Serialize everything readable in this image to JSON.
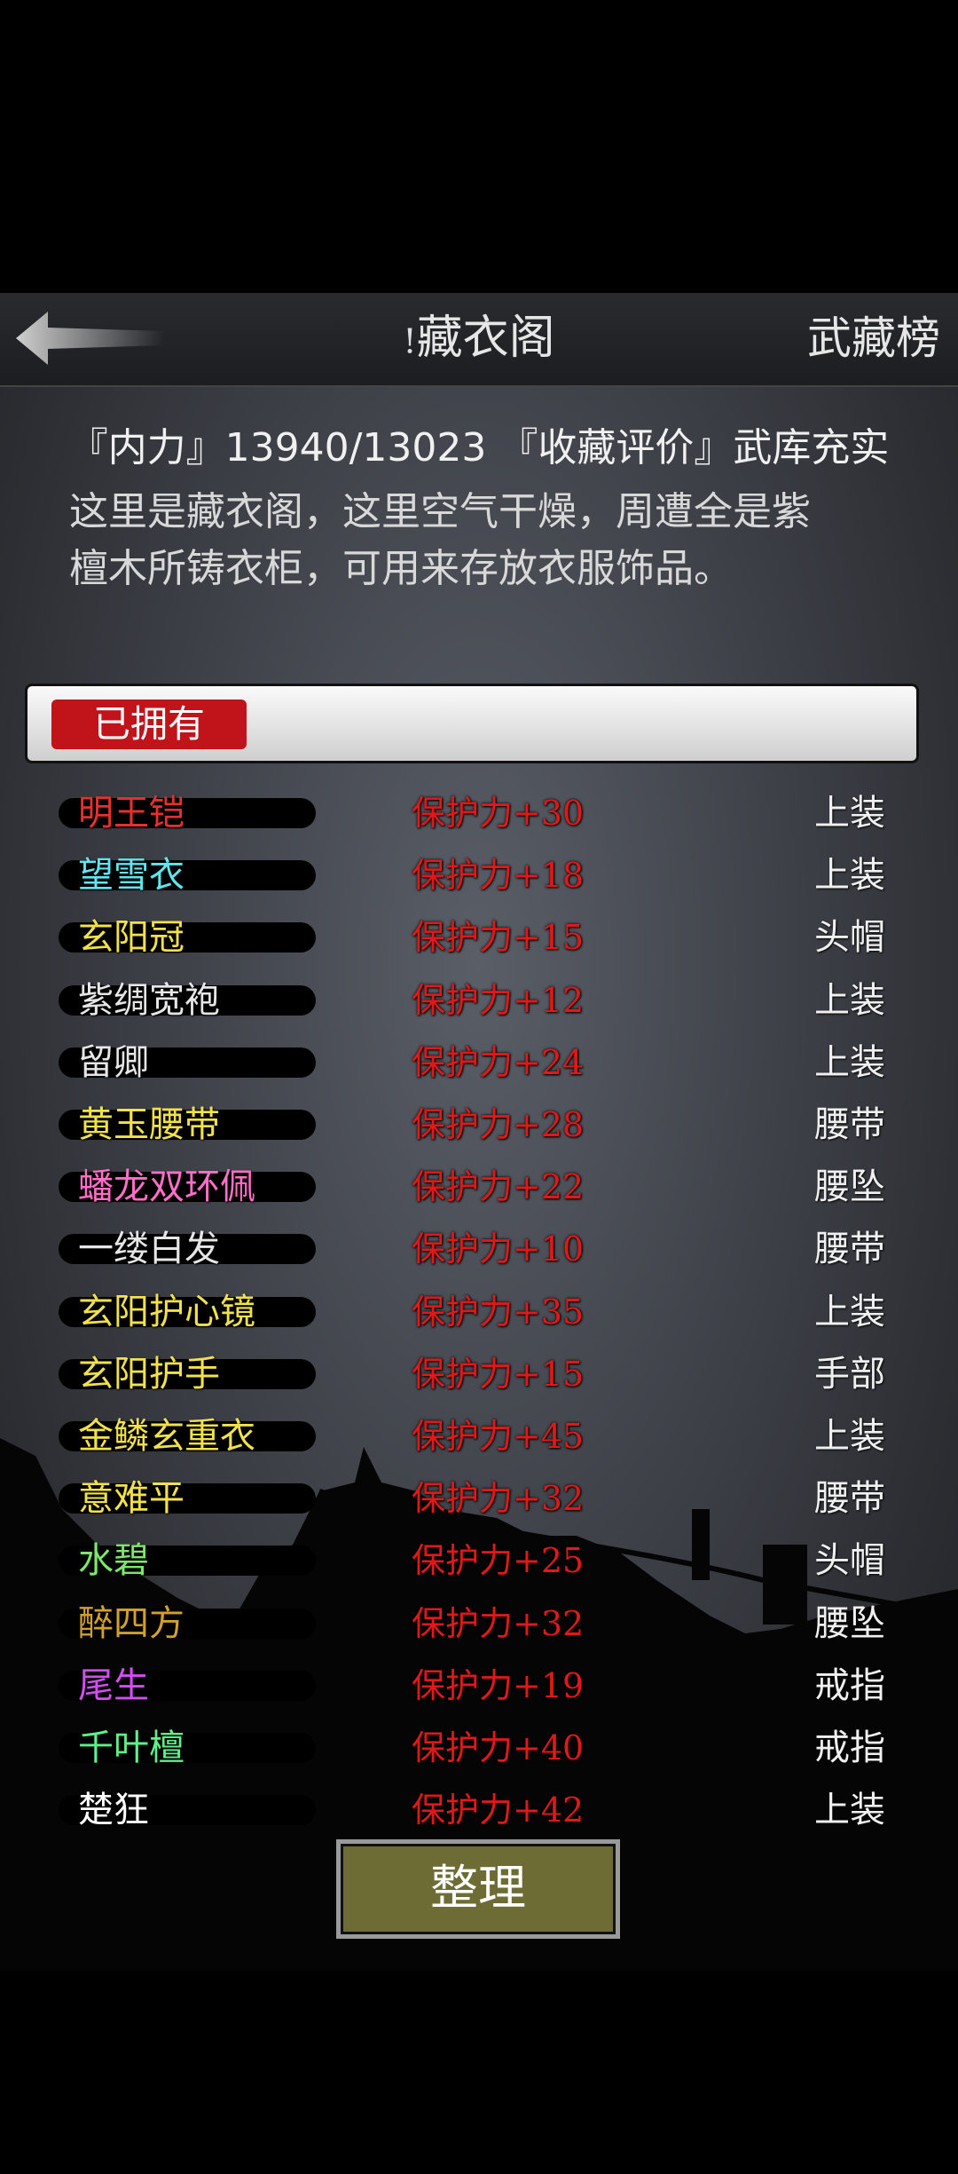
{
  "header": {
    "title_mark": "!",
    "title": "藏衣阁",
    "rank_link": "武藏榜"
  },
  "stats": {
    "text": "『内力』13940/13023 『收藏评价』武库充实"
  },
  "description": {
    "line1": "这里是藏衣阁，这里空气干燥，周遭全是紫",
    "line2": "檀木所铸衣柜，可用来存放衣服饰品。"
  },
  "tab": {
    "owned_label": "已拥有"
  },
  "items": [
    {
      "name": "明王铠",
      "color": "#e53030",
      "stat": "保护力+30",
      "slot": "上装"
    },
    {
      "name": "望雪衣",
      "color": "#5fe6f0",
      "stat": "保护力+18",
      "slot": "上装"
    },
    {
      "name": "玄阳冠",
      "color": "#f2e24a",
      "stat": "保护力+15",
      "slot": "头帽"
    },
    {
      "name": "紫绸宽袍",
      "color": "#e6e6e6",
      "stat": "保护力+12",
      "slot": "上装"
    },
    {
      "name": "留卿",
      "color": "#e6e6e6",
      "stat": "保护力+24",
      "slot": "上装"
    },
    {
      "name": "黄玉腰带",
      "color": "#f2e24a",
      "stat": "保护力+28",
      "slot": "腰带"
    },
    {
      "name": "蟠龙双环佩",
      "color": "#ff6ec7",
      "stat": "保护力+22",
      "slot": "腰坠"
    },
    {
      "name": "一缕白发",
      "color": "#e6e6e6",
      "stat": "保护力+10",
      "slot": "腰带"
    },
    {
      "name": "玄阳护心镜",
      "color": "#f2e24a",
      "stat": "保护力+35",
      "slot": "上装"
    },
    {
      "name": "玄阳护手",
      "color": "#f2e24a",
      "stat": "保护力+15",
      "slot": "手部"
    },
    {
      "name": "金鳞玄重衣",
      "color": "#f2e24a",
      "stat": "保护力+45",
      "slot": "上装"
    },
    {
      "name": "意难平",
      "color": "#f2e24a",
      "stat": "保护力+32",
      "slot": "腰带"
    },
    {
      "name": "水碧",
      "color": "#7ee66a",
      "stat": "保护力+25",
      "slot": "头帽"
    },
    {
      "name": "醉四方",
      "color": "#d2a02c",
      "stat": "保护力+32",
      "slot": "腰坠"
    },
    {
      "name": "尾生",
      "color": "#d24ef0",
      "stat": "保护力+19",
      "slot": "戒指"
    },
    {
      "name": "千叶檀",
      "color": "#5ff08a",
      "stat": "保护力+40",
      "slot": "戒指"
    },
    {
      "name": "楚狂",
      "color": "#ffffff",
      "stat": "保护力+42",
      "slot": "上装"
    }
  ],
  "sort_button": "整理",
  "icons": {
    "back": "back-arrow-icon"
  }
}
